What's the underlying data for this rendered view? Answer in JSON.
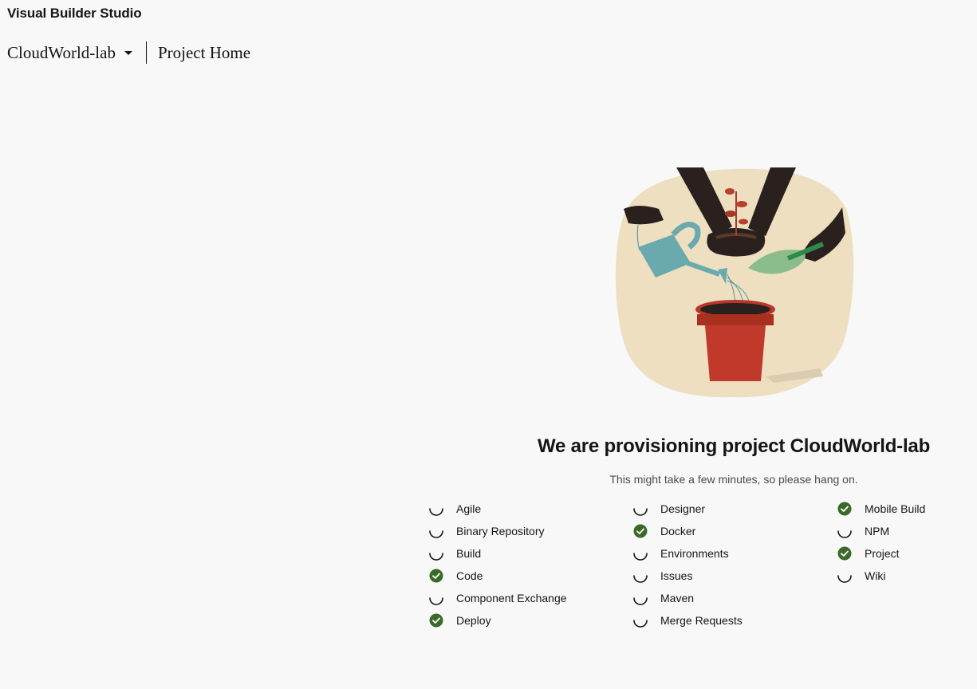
{
  "header": {
    "app_title": "Visual Builder Studio",
    "project_name": "CloudWorld-lab",
    "page_title": "Project Home"
  },
  "main": {
    "heading": "We are provisioning project CloudWorld-lab",
    "subtext": "This might take a few minutes, so please hang on."
  },
  "status_colors": {
    "done": "#3b6a28",
    "pending": "#161513"
  },
  "services": [
    [
      {
        "name": "Agile",
        "status": "pending"
      },
      {
        "name": "Binary Repository",
        "status": "pending"
      },
      {
        "name": "Build",
        "status": "pending"
      },
      {
        "name": "Code",
        "status": "done"
      },
      {
        "name": "Component Exchange",
        "status": "pending"
      },
      {
        "name": "Deploy",
        "status": "done"
      }
    ],
    [
      {
        "name": "Designer",
        "status": "pending"
      },
      {
        "name": "Docker",
        "status": "done"
      },
      {
        "name": "Environments",
        "status": "pending"
      },
      {
        "name": "Issues",
        "status": "pending"
      },
      {
        "name": "Maven",
        "status": "pending"
      },
      {
        "name": "Merge Requests",
        "status": "pending"
      }
    ],
    [
      {
        "name": "Mobile Build",
        "status": "done"
      },
      {
        "name": "NPM",
        "status": "pending"
      },
      {
        "name": "Project",
        "status": "done"
      },
      {
        "name": "Wiki",
        "status": "pending"
      }
    ]
  ]
}
